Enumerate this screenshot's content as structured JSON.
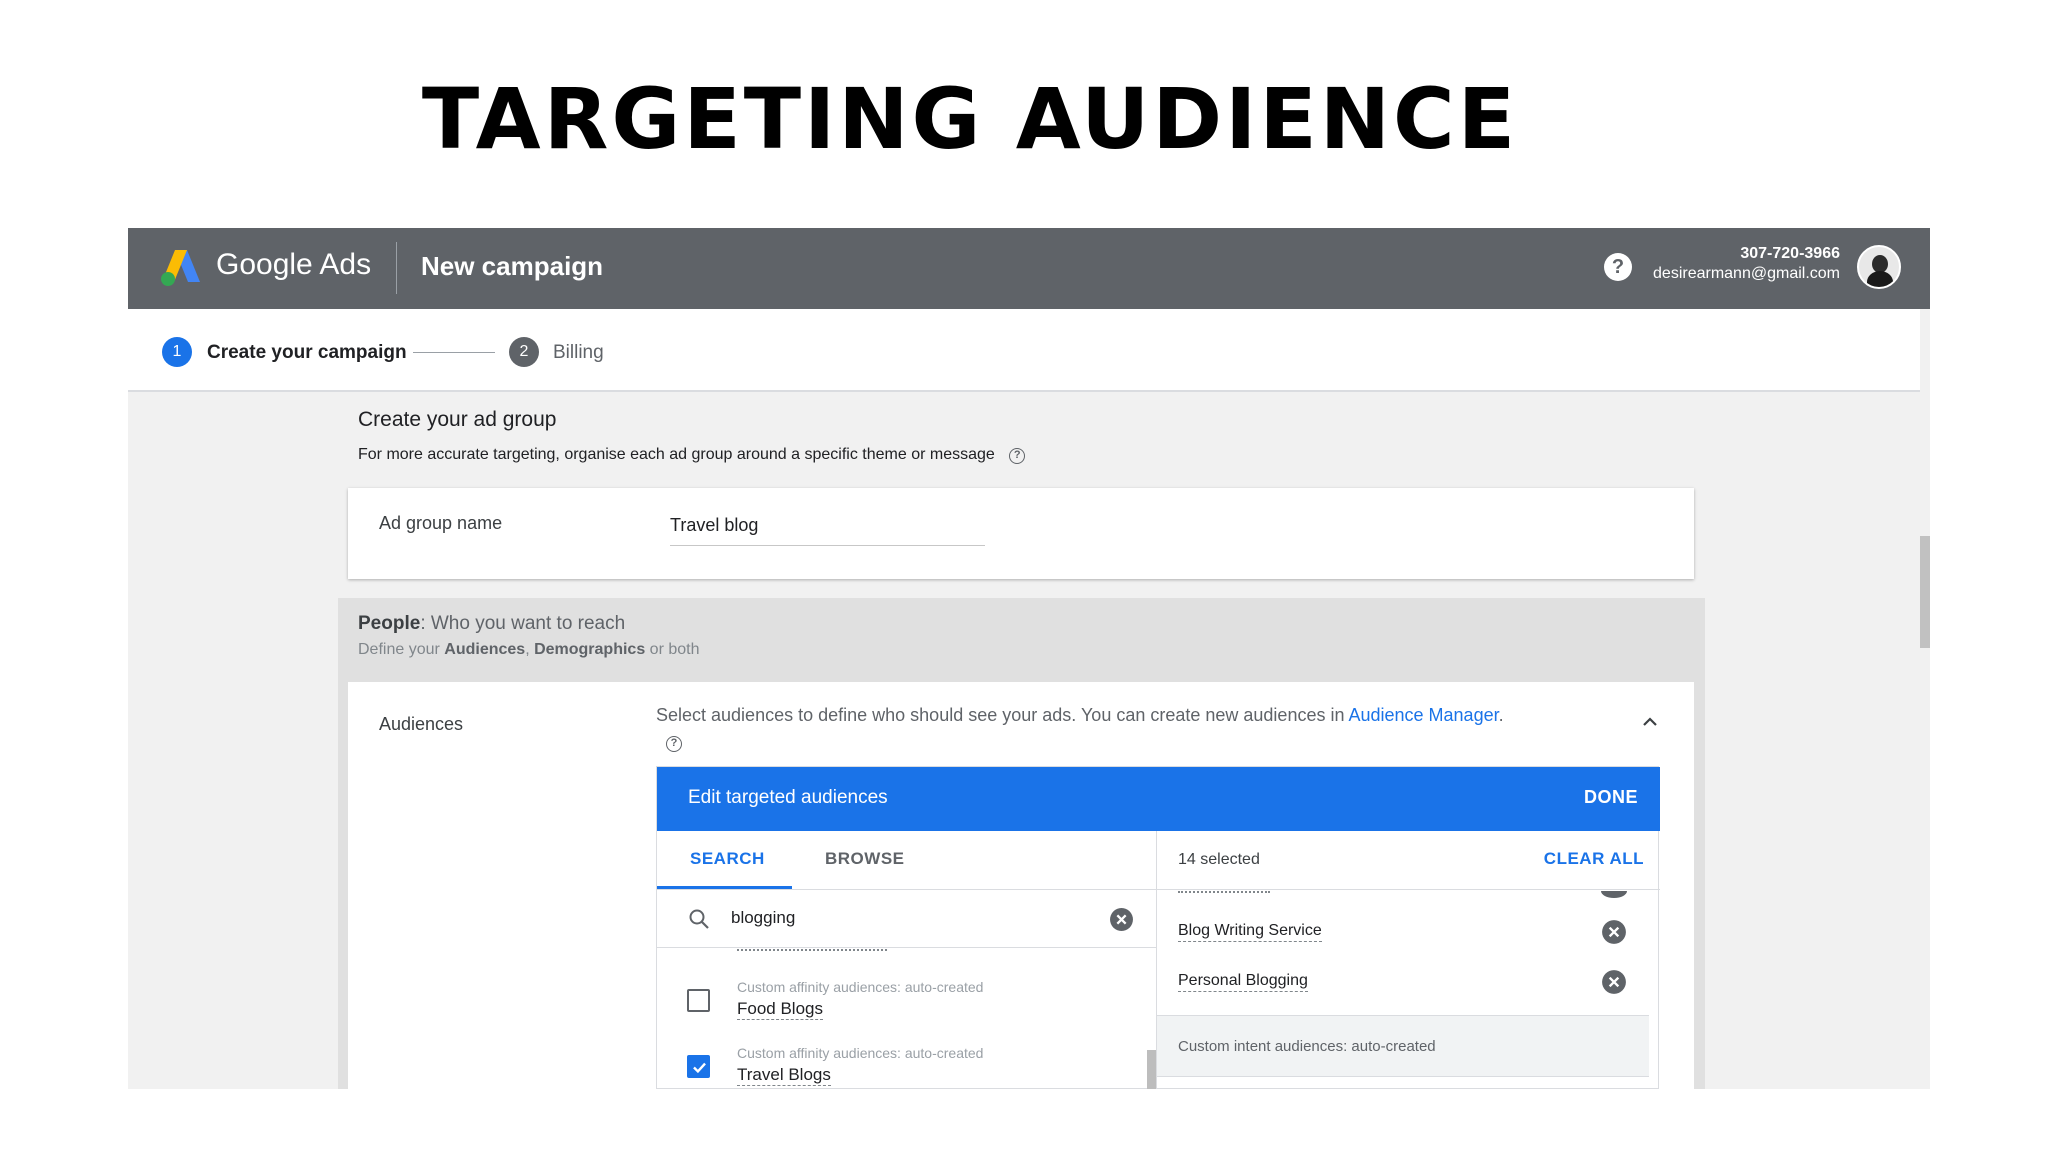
{
  "slide": {
    "title": "TARGETING AUDIENCE"
  },
  "topbar": {
    "brand": "Google Ads",
    "campaign_title": "New campaign",
    "help_glyph": "?",
    "account_phone": "307-720-3966",
    "account_email": "desirearmann@gmail.com",
    "color": "#5f6368"
  },
  "stepper": {
    "steps": [
      {
        "number": "1",
        "label": "Create your campaign",
        "state": "active",
        "color": "#1a73e8"
      },
      {
        "number": "2",
        "label": "Billing",
        "state": "inactive",
        "color": "#5f6368"
      }
    ]
  },
  "ad_group": {
    "section_title": "Create your ad group",
    "description": "For more accurate targeting, organise each ad group around a specific theme or message",
    "help_glyph": "?",
    "name_label": "Ad group name",
    "name_value": "Travel blog"
  },
  "people": {
    "title_bold": "People",
    "title_rest": ": Who you want to reach",
    "sub_prefix": "Define your ",
    "sub_audiences": "Audiences",
    "sub_comma": ", ",
    "sub_demographics": "Demographics",
    "sub_suffix": " or both"
  },
  "audiences": {
    "label": "Audiences",
    "description": "Select audiences to define who should see your ads.  You can create new audiences in ",
    "link_text": "Audience Manager",
    "link_suffix": ".",
    "help_glyph": "?",
    "editor": {
      "title": "Edit targeted audiences",
      "done_label": "DONE",
      "accent": "#1a73e8",
      "tabs": [
        {
          "label": "SEARCH",
          "active": true
        },
        {
          "label": "BROWSE",
          "active": false
        }
      ],
      "search_value": "blogging",
      "results": [
        {
          "type": "Custom affinity audiences: auto-created",
          "name": "Food Blogs",
          "checked": false
        },
        {
          "type": "Custom affinity audiences: auto-created",
          "name": "Travel Blogs",
          "checked": true
        }
      ],
      "selected_count": "14 selected",
      "clear_all_label": "CLEAR ALL",
      "selected_items": [
        {
          "name": "Blog Writing Service"
        },
        {
          "name": "Personal Blogging"
        }
      ],
      "group_header": "Custom intent audiences: auto-created"
    }
  },
  "icons": {
    "logo": "google-ads-logo-icon",
    "help": "help-circle-icon",
    "avatar": "user-avatar",
    "chevron": "chevron-up-icon",
    "search": "search-icon",
    "clear": "clear-circle-icon",
    "remove": "remove-circle-icon",
    "check": "check-icon"
  }
}
